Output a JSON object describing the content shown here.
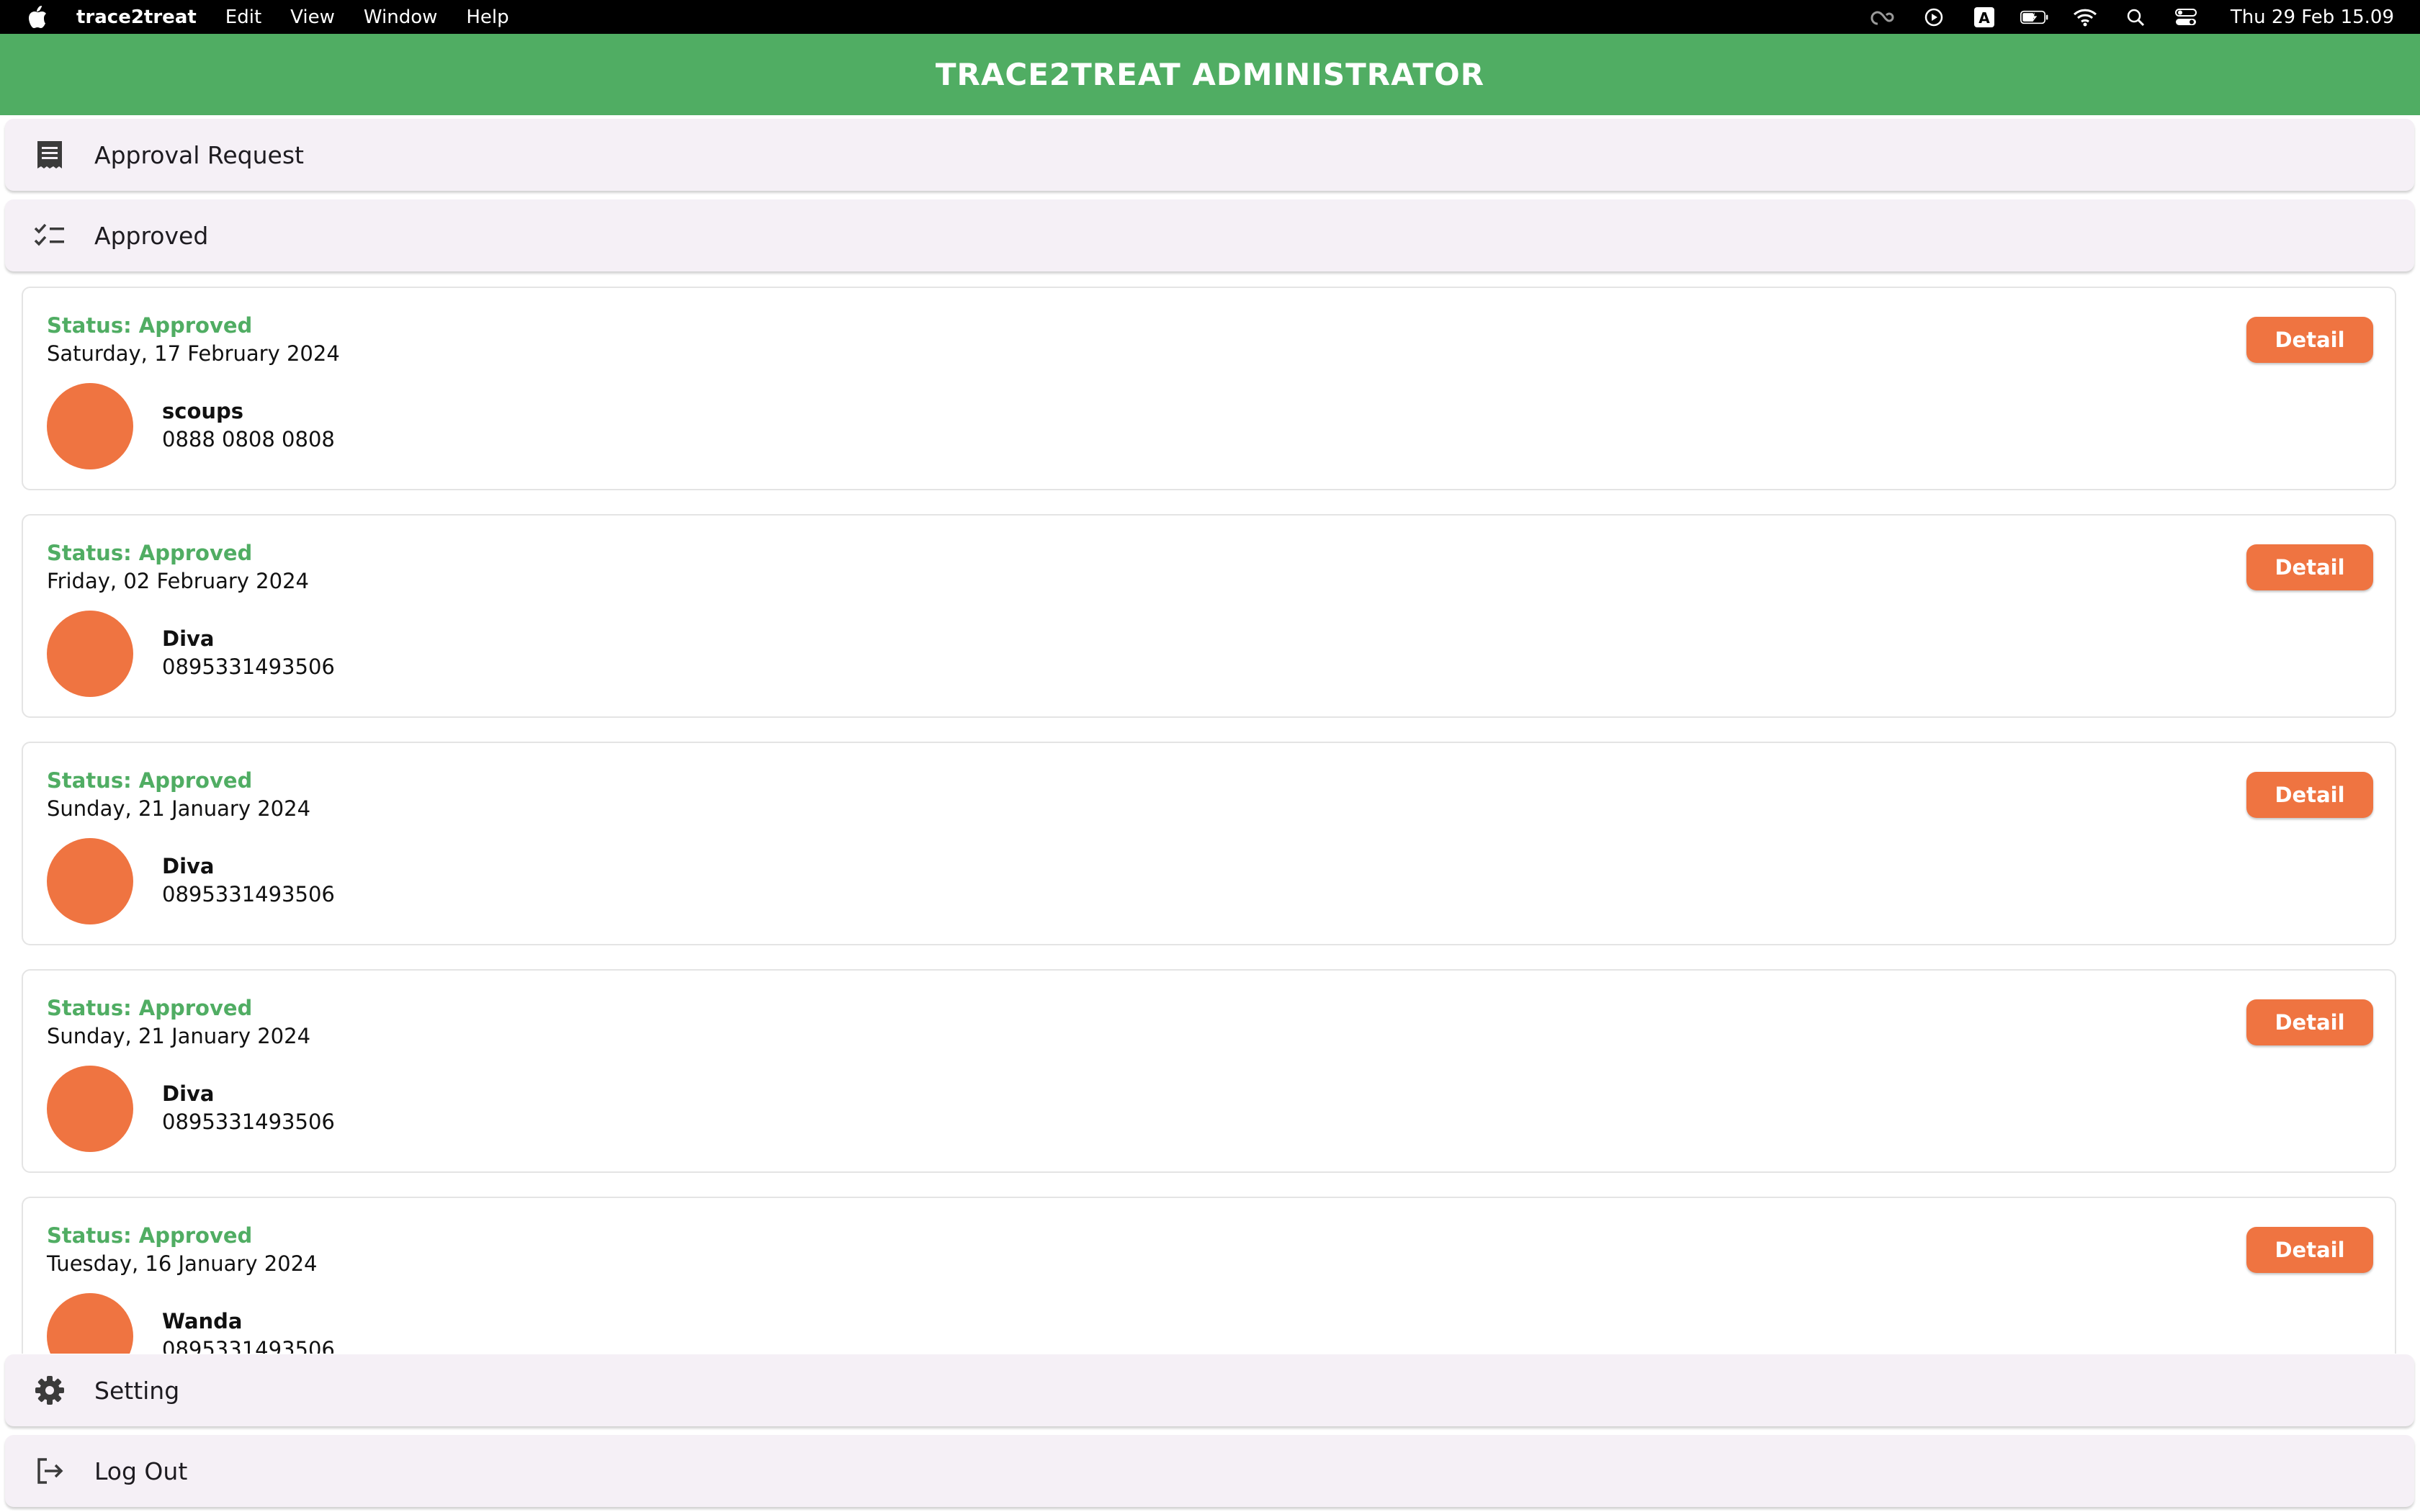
{
  "menubar": {
    "app_name": "trace2treat",
    "menus": [
      "Edit",
      "View",
      "Window",
      "Help"
    ],
    "clock": "Thu 29 Feb  15.09",
    "status_icons": [
      "creative-cloud-icon",
      "play-circle-icon",
      "input-source-icon",
      "battery-charging-icon",
      "wifi-icon",
      "spotlight-search-icon",
      "control-center-icon"
    ]
  },
  "header": {
    "title": "TRACE2TREAT ADMINISTRATOR",
    "color": "#50ad63"
  },
  "nav": {
    "approval_request": "Approval Request",
    "approved": "Approved",
    "setting": "Setting",
    "logout": "Log Out"
  },
  "colors": {
    "accent": "#ef7441",
    "status_green": "#50ad63",
    "tile_bg": "#f5f0f6"
  },
  "cards": [
    {
      "status": "Status: Approved",
      "date": "Saturday, 17 February 2024",
      "name": "scoups",
      "phone": "0888 0808 0808",
      "button": "Detail"
    },
    {
      "status": "Status: Approved",
      "date": "Friday, 02 February 2024",
      "name": "Diva",
      "phone": "0895331493506",
      "button": "Detail"
    },
    {
      "status": "Status: Approved",
      "date": "Sunday, 21 January 2024",
      "name": "Diva",
      "phone": "0895331493506",
      "button": "Detail"
    },
    {
      "status": "Status: Approved",
      "date": "Sunday, 21 January 2024",
      "name": "Diva",
      "phone": "0895331493506",
      "button": "Detail"
    },
    {
      "status": "Status: Approved",
      "date": "Tuesday, 16 January 2024",
      "name": "Wanda",
      "phone": "0895331493506",
      "button": "Detail"
    }
  ]
}
